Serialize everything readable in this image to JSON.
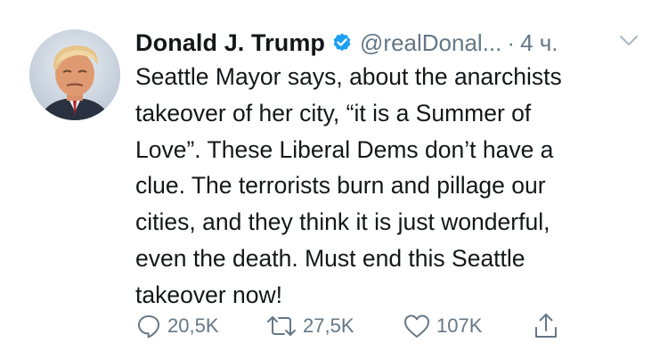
{
  "tweet": {
    "author_name": "Donald J. Trump",
    "handle": "@realDonal...",
    "separator": "·",
    "time": "4 ч.",
    "verified_icon": "verified-badge-icon",
    "menu_icon": "chevron-down-icon",
    "text_lines": [
      "Seattle Mayor says, about the anarchists",
      "takeover of her city, “it is a Summer of",
      "Love”. These Liberal Dems don’t have a",
      "clue. The terrorists burn and pillage our",
      "cities, and they think it is just wonderful,",
      "even the death. Must end this Seattle",
      "takeover now!"
    ]
  },
  "actions": {
    "reply": {
      "icon": "reply-icon",
      "count": "20,5K"
    },
    "retweet": {
      "icon": "retweet-icon",
      "count": "27,5K"
    },
    "like": {
      "icon": "heart-icon",
      "count": "107K"
    },
    "share": {
      "icon": "share-icon"
    }
  },
  "colors": {
    "text": "#14171a",
    "secondary": "#657786",
    "verified": "#1da1f2",
    "background": "#ffffff"
  }
}
